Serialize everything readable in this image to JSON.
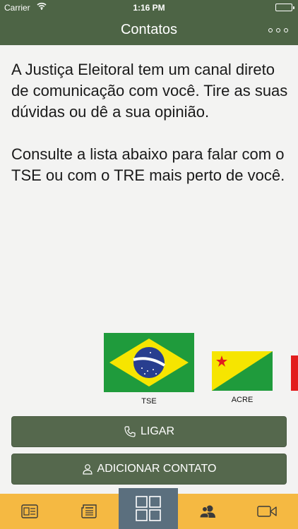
{
  "status_bar": {
    "carrier": "Carrier",
    "time": "1:16 PM"
  },
  "nav": {
    "title": "Contatos",
    "menu_icon": "more-dots-icon"
  },
  "intro": {
    "paragraph_1": "A Justiça Eleitoral tem um canal direto de comunicação com você. Tire as suas dúvidas ou dê a sua opinião.",
    "paragraph_2": "Consulte a lista abaixo para falar com o TSE ou com o TRE mais perto de você."
  },
  "flags": [
    {
      "label": "TSE",
      "icon": "brazil-flag-icon"
    },
    {
      "label": "ACRE",
      "icon": "acre-flag-icon"
    }
  ],
  "actions": {
    "call_label": "LIGAR",
    "call_icon": "phone-icon",
    "add_contact_label": "ADICIONAR CONTATO",
    "add_contact_icon": "person-icon"
  },
  "tabs": [
    {
      "icon": "news-panel-icon"
    },
    {
      "icon": "newspaper-icon"
    },
    {
      "icon": "grid-icon",
      "active": true
    },
    {
      "icon": "contacts-icon"
    },
    {
      "icon": "video-camera-icon"
    }
  ],
  "colors": {
    "header": "#4d6445",
    "button": "#55684d",
    "tab_bar": "#f5b942",
    "tab_active": "#5b6f7e",
    "flag_green": "#1f9b3c",
    "flag_yellow": "#f6e500",
    "flag_blue": "#283e8f"
  }
}
